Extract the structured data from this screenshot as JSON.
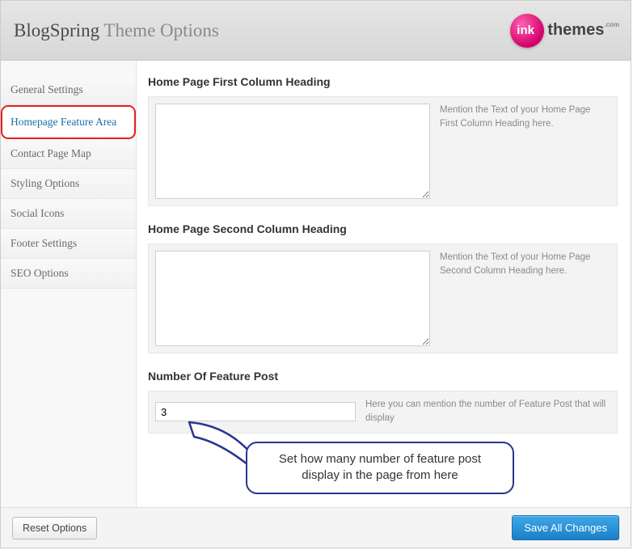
{
  "header": {
    "title_strong": "BlogSpring",
    "title_light": "Theme Options",
    "logo_text": "themes"
  },
  "sidebar": {
    "items": [
      {
        "label": "General Settings"
      },
      {
        "label": "Homepage Feature Area"
      },
      {
        "label": "Contact Page Map"
      },
      {
        "label": "Styling Options"
      },
      {
        "label": "Social Icons"
      },
      {
        "label": "Footer Settings"
      },
      {
        "label": "SEO Options"
      }
    ]
  },
  "sections": {
    "s1": {
      "title": "Home Page First Column Heading",
      "value": "",
      "help": "Mention the Text of your Home Page First Column Heading here."
    },
    "s2": {
      "title": "Home Page Second Column Heading",
      "value": "",
      "help": "Mention the Text of your Home Page Second Column Heading here."
    },
    "s3": {
      "title": "Number Of Feature Post",
      "value": "3",
      "help": "Here you can mention the number of Feature Post that will display"
    }
  },
  "footer": {
    "reset": "Reset Options",
    "save": "Save All Changes"
  },
  "callout": {
    "text": "Set how many number of feature post display in the page from here"
  }
}
